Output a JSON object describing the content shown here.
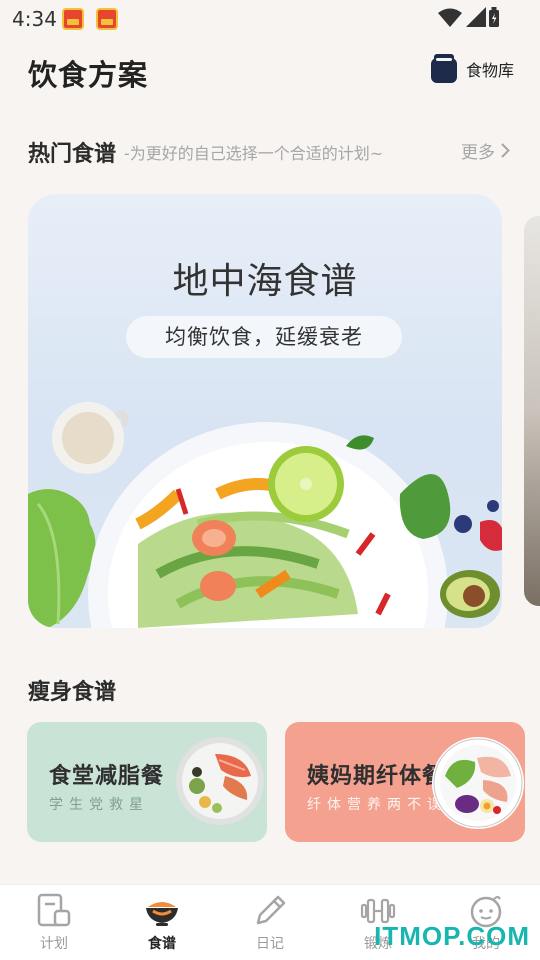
{
  "status_bar": {
    "time": "4:34"
  },
  "header": {
    "title": "饮食方案",
    "food_library_label": "食物库"
  },
  "popular_section": {
    "title": "热门食谱",
    "subtitle": "-为更好的自己选择一个合适的计划~",
    "more_label": "更多"
  },
  "hero_card": {
    "title": "地中海食谱",
    "subtitle": "均衡饮食，延缓衰老"
  },
  "slim_section": {
    "title": "瘦身食谱",
    "cards": [
      {
        "title": "食堂减脂餐",
        "subtitle": "学生党救星"
      },
      {
        "title": "姨妈期纤体餐",
        "subtitle": "纤体营养两不误"
      }
    ]
  },
  "bottom_nav": {
    "items": [
      {
        "label": "计划",
        "icon": "plan-icon"
      },
      {
        "label": "食谱",
        "icon": "bowl-icon",
        "active": true
      },
      {
        "label": "日记",
        "icon": "pencil-icon"
      },
      {
        "label": "锻炼",
        "icon": "dumbbell-icon"
      },
      {
        "label": "我的",
        "icon": "face-icon"
      }
    ]
  },
  "watermark": "ITMOP.COM",
  "colors": {
    "background": "#f7f4f1",
    "card_green": "#c9e3d7",
    "card_red": "#f4a190",
    "nav_active_accent": "#f08c3a",
    "watermark": "#19b5b0"
  }
}
